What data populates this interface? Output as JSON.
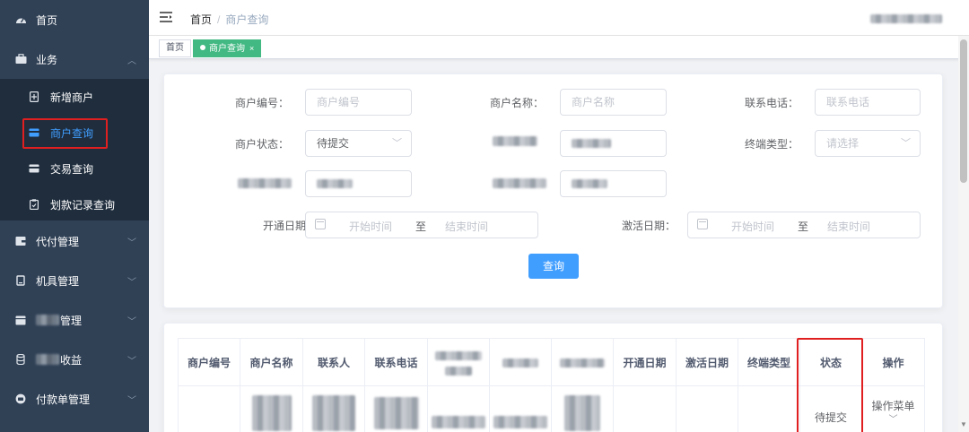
{
  "sidebar": {
    "items": [
      {
        "label": "首页",
        "icon": "dashboard-icon"
      },
      {
        "label": "业务",
        "icon": "briefcase-icon",
        "expanded": true
      },
      {
        "label": "代付管理",
        "icon": "wallet-icon"
      },
      {
        "label": "机具管理",
        "icon": "device-icon"
      },
      {
        "label": "管理",
        "icon": "folder-icon"
      },
      {
        "label": "收益",
        "icon": "database-icon"
      },
      {
        "label": "付款单管理",
        "icon": "payment-icon"
      }
    ],
    "subitems": [
      {
        "label": "新增商户",
        "icon": "add-document-icon"
      },
      {
        "label": "商户查询",
        "icon": "card-icon",
        "active": true
      },
      {
        "label": "交易查询",
        "icon": "card-icon"
      },
      {
        "label": "划款记录查询",
        "icon": "clipboard-icon"
      }
    ]
  },
  "header": {
    "breadcrumb": {
      "home": "首页",
      "separator": "/",
      "current": "商户查询"
    }
  },
  "tags": [
    {
      "label": "首页",
      "active": false
    },
    {
      "label": "商户查询",
      "active": true,
      "close": "×"
    }
  ],
  "filters": {
    "merchant_no": {
      "label": "商户编号：",
      "placeholder": "商户编号"
    },
    "merchant_name": {
      "label": "商户名称：",
      "placeholder": "商户名称"
    },
    "phone": {
      "label": "联系电话：",
      "placeholder": "联系电话"
    },
    "status": {
      "label": "商户状态：",
      "value": "待提交"
    },
    "terminal_type": {
      "label": "终端类型：",
      "placeholder": "请选择"
    },
    "open_date": {
      "label": "开通日期：",
      "start": "开始时间",
      "to": "至",
      "end": "结束时间"
    },
    "activate_date": {
      "label": "激活日期：",
      "start": "开始时间",
      "to": "至",
      "end": "结束时间"
    },
    "query_button": "查询"
  },
  "table": {
    "headers": [
      "商户编号",
      "商户名称",
      "联系人",
      "联系电话",
      "",
      "",
      "",
      "开通日期",
      "激活日期",
      "终端类型",
      "状态",
      "操作"
    ],
    "rows": [
      {
        "status": "待提交",
        "ops": "操作菜单"
      }
    ]
  },
  "colors": {
    "sidebar_bg": "#304156",
    "submenu_bg": "#1f2d3d",
    "active_blue": "#409eff",
    "tag_green": "#42b983",
    "highlight_red": "#e02020"
  }
}
